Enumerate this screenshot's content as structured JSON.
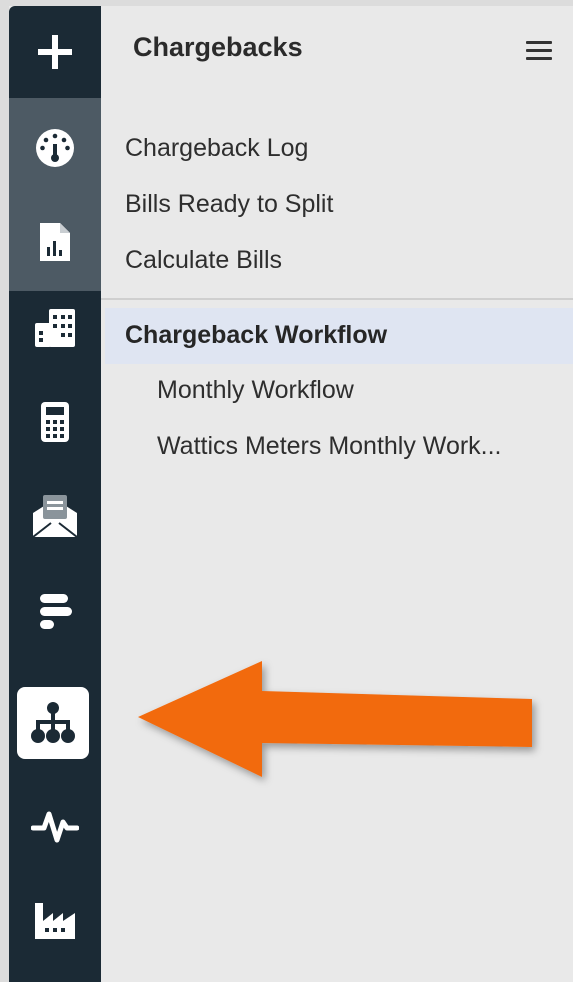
{
  "panel": {
    "title": "Chargebacks",
    "links": [
      "Chargeback Log",
      "Bills Ready to Split",
      "Calculate Bills"
    ],
    "section": {
      "label": "Chargeback Workflow",
      "items": [
        "Monthly Workflow",
        "Wattics Meters Monthly Work..."
      ]
    }
  },
  "rail": {
    "items": [
      {
        "icon": "plus-icon"
      },
      {
        "icon": "dashboard-gauge-icon"
      },
      {
        "icon": "report-document-icon"
      },
      {
        "icon": "buildings-icon"
      },
      {
        "icon": "calculator-icon"
      },
      {
        "icon": "mail-open-icon"
      },
      {
        "icon": "gantt-bars-icon"
      },
      {
        "icon": "org-chart-icon",
        "active": true
      },
      {
        "icon": "activity-pulse-icon"
      },
      {
        "icon": "factory-icon"
      }
    ]
  },
  "colors": {
    "rail": "#1b2a35",
    "rail_highlight": "#4d5a64",
    "panel_bg": "#e9e9e9",
    "section_highlight": "#dfe5f2",
    "annotation_arrow": "#f26a0f"
  }
}
